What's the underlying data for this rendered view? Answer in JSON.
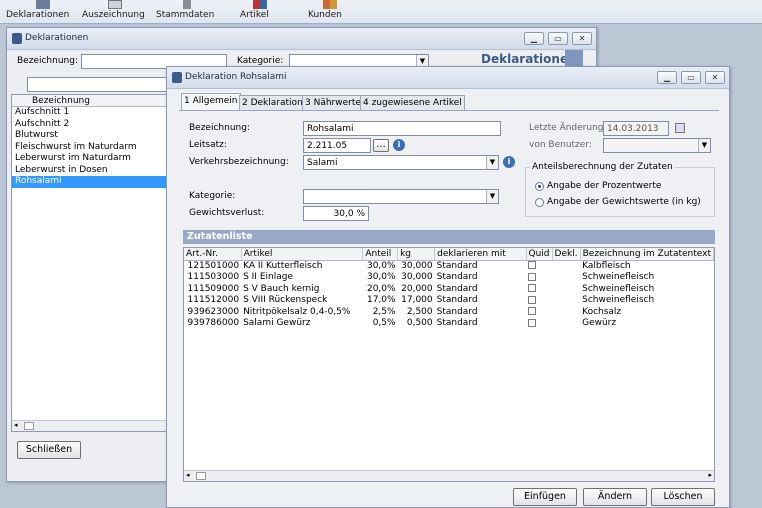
{
  "toolbar": {
    "items": [
      {
        "label": "Deklarationen",
        "icon": "declarations-icon"
      },
      {
        "label": "Auszeichnung",
        "icon": "label-printer-icon"
      },
      {
        "label": "Stammdaten",
        "icon": "master-data-icon"
      },
      {
        "label": "Artikel",
        "icon": "article-icon"
      },
      {
        "label": "Kunden",
        "icon": "customers-icon"
      }
    ]
  },
  "main": {
    "title": "Deklarationen",
    "header": "Deklarationen",
    "search_label": "Bezeichnung:",
    "category_label": "Kategorie:",
    "column": "Bezeichnung",
    "items": [
      "Aufschnitt 1",
      "Aufschnitt 2",
      "Blutwurst",
      "Fleischwurst im Naturdarm",
      "Leberwurst im Naturdarm",
      "Leberwurst in Dosen",
      "Rohsalami"
    ],
    "selected_index": 6,
    "close_button": "Schließen"
  },
  "dialog": {
    "title": "Deklaration Rohsalami",
    "tabs": [
      "1 Allgemein",
      "2 Deklaration",
      "3 Nährwerte",
      "4 zugewiesene Artikel"
    ],
    "fields": {
      "bezeichnung_label": "Bezeichnung:",
      "bezeichnung": "Rohsalami",
      "leitsatz_label": "Leitsatz:",
      "leitsatz": "2.211.05",
      "verkehr_label": "Verkehrsbezeichnung:",
      "verkehr": "Salami",
      "kategorie_label": "Kategorie:",
      "kategorie": "",
      "gewicht_label": "Gewichtsverlust:",
      "gewicht": "30,0 %",
      "aenderung_label": "Letzte Änderung:",
      "aenderung": "14.03.2013",
      "benutzer_label": "von Benutzer:",
      "benutzer": ""
    },
    "anteil": {
      "title": "Anteilsberechnung der Zutaten",
      "opt1": "Angabe der Prozentwerte",
      "opt2": "Angabe der Gewichtswerte (in kg)",
      "selected": 1
    },
    "zutaten": {
      "title": "Zutatenliste",
      "columns": [
        "Art.-Nr.",
        "Artikel",
        "Anteil",
        "kg",
        "deklarieren mit",
        "Quid",
        "Dekl.",
        "Bezeichnung im Zutatentext"
      ],
      "rows": [
        {
          "nr": "121501000",
          "artikel": "KA II Kutterfleisch",
          "anteil": "30,0%",
          "kg": "30,000",
          "dekl": "Standard",
          "bez": "Kalbfleisch"
        },
        {
          "nr": "111503000",
          "artikel": "S II Einlage",
          "anteil": "30,0%",
          "kg": "30,000",
          "dekl": "Standard",
          "bez": "Schweinefleisch"
        },
        {
          "nr": "111509000",
          "artikel": "S V Bauch kernig",
          "anteil": "20,0%",
          "kg": "20,000",
          "dekl": "Standard",
          "bez": "Schweinefleisch"
        },
        {
          "nr": "111512000",
          "artikel": "S VIII Rückenspeck",
          "anteil": "17,0%",
          "kg": "17,000",
          "dekl": "Standard",
          "bez": "Schweinefleisch"
        },
        {
          "nr": "939623000",
          "artikel": "Nitritpökelsalz 0,4-0,5%",
          "anteil": "2,5%",
          "kg": "2,500",
          "dekl": "Standard",
          "bez": "Kochsalz"
        },
        {
          "nr": "939786000",
          "artikel": "Salami Gewürz",
          "anteil": "0,5%",
          "kg": "0,500",
          "dekl": "Standard",
          "bez": "Gewürz"
        }
      ]
    },
    "buttons": {
      "insert": "Einfügen",
      "edit": "Ändern",
      "delete": "Löschen"
    }
  }
}
